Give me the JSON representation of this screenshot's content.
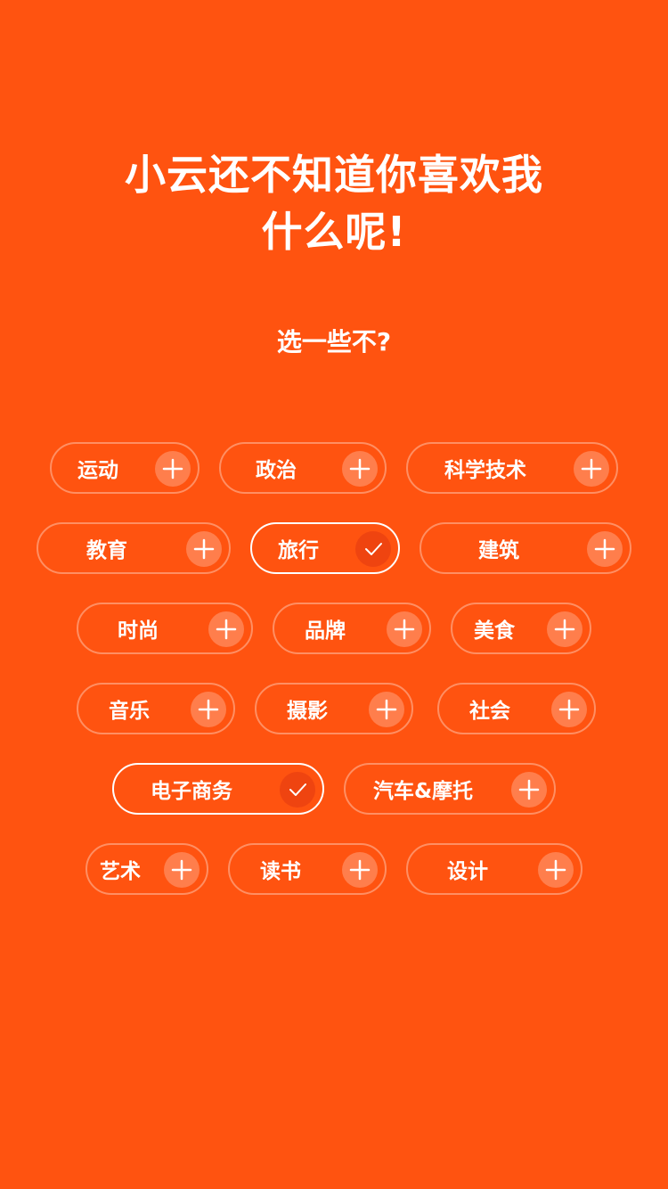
{
  "header": {
    "title_line1": "小云还不知道你喜欢我",
    "title_line2": "什么呢!",
    "subtitle": "选一些不?"
  },
  "icons": {
    "unselected": "plus-icon",
    "selected": "check-icon"
  },
  "tags": [
    {
      "label": "运动",
      "selected": false
    },
    {
      "label": "政治",
      "selected": false
    },
    {
      "label": "科学技术",
      "selected": false
    },
    {
      "label": "教育",
      "selected": false
    },
    {
      "label": "旅行",
      "selected": true
    },
    {
      "label": "建筑",
      "selected": false
    },
    {
      "label": "时尚",
      "selected": false
    },
    {
      "label": "品牌",
      "selected": false
    },
    {
      "label": "美食",
      "selected": false
    },
    {
      "label": "音乐",
      "selected": false
    },
    {
      "label": "摄影",
      "selected": false
    },
    {
      "label": "社会",
      "selected": false
    },
    {
      "label": "电子商务",
      "selected": true
    },
    {
      "label": "汽车&摩托",
      "selected": false
    },
    {
      "label": "艺术",
      "selected": false
    },
    {
      "label": "读书",
      "selected": false
    },
    {
      "label": "设计",
      "selected": false
    }
  ]
}
